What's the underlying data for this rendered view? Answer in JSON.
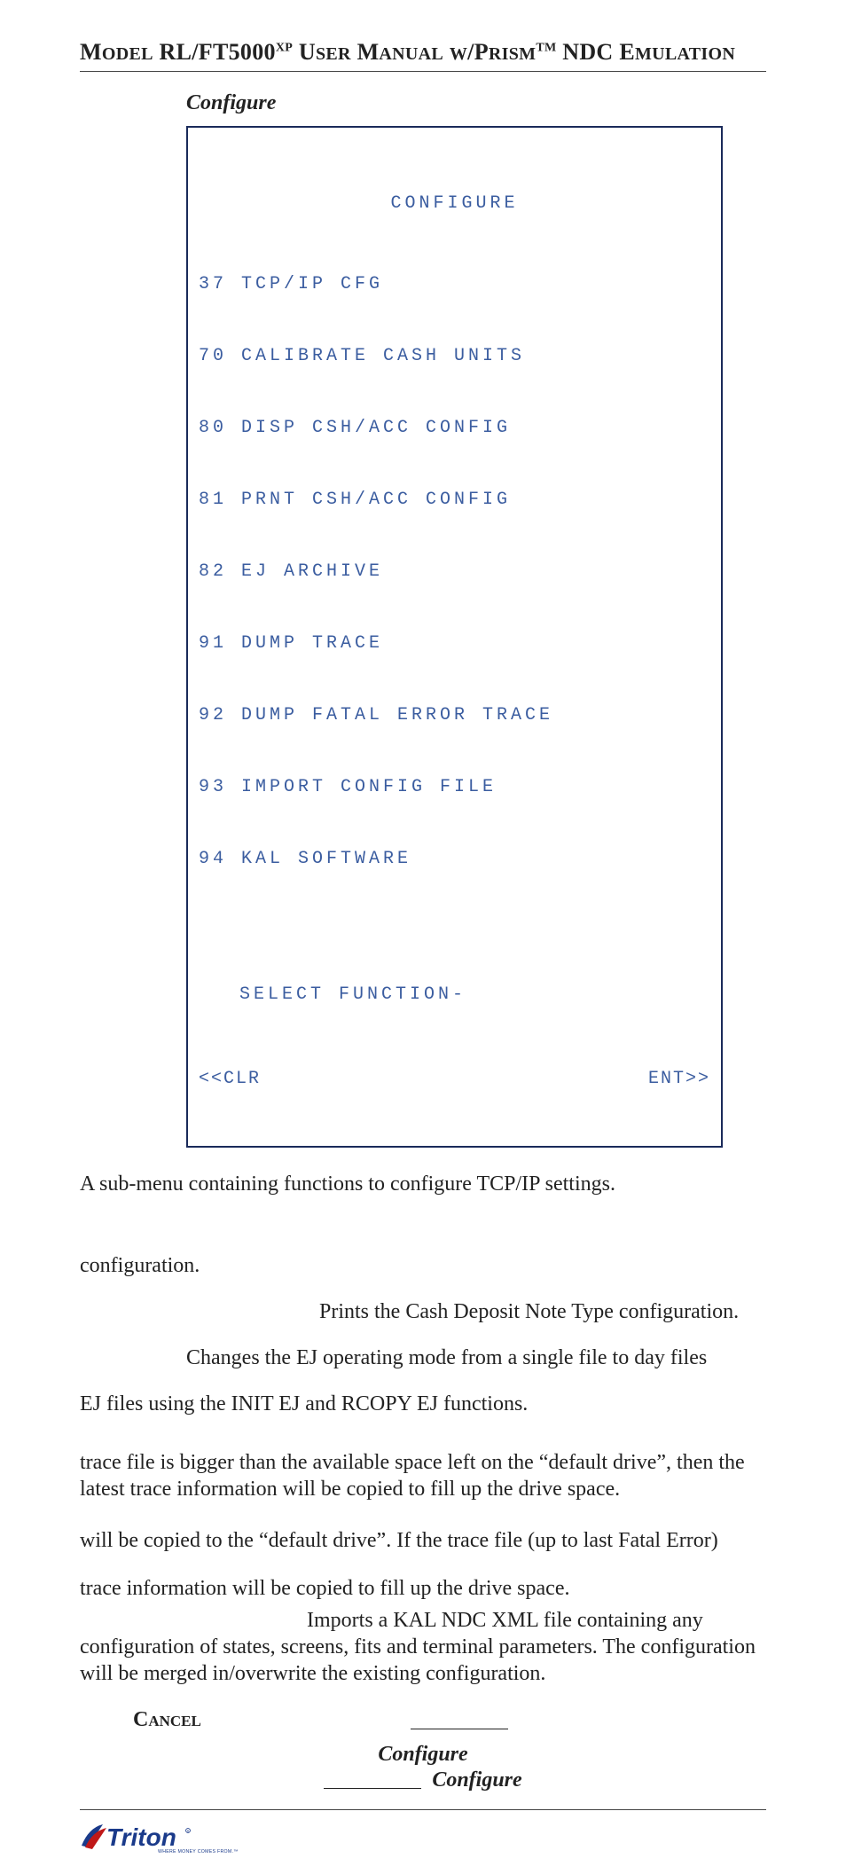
{
  "header": {
    "title_html": "M<span style='font-size:20px'>ODEL</span> RL/FT5000<sup style='font-size:14px'>XP</sup> U<span style='font-size:20px'>SER</span> M<span style='font-size:20px'>ANUAL</span> <span style='font-size:20px'>W</span>/P<span style='font-size:20px'>RISM</span><sup style='font-size:14px'>TM</sup> NDC E<span style='font-size:20px'>MULATION</span>"
  },
  "section_label": "Configure",
  "terminal": {
    "title": "CONFIGURE",
    "lines": [
      "37 TCP/IP CFG",
      "70 CALIBRATE CASH UNITS",
      "80 DISP CSH/ACC CONFIG",
      "81 PRNT CSH/ACC CONFIG",
      "82 EJ ARCHIVE",
      "91 DUMP TRACE",
      "92 DUMP FATAL ERROR TRACE",
      "93 IMPORT CONFIG FILE",
      "94 KAL SOFTWARE"
    ],
    "prompt": "SELECT FUNCTION-",
    "left": "<<CLR",
    "right": "ENT>>"
  },
  "para": {
    "p1": "A sub-menu containing functions to configure TCP/IP settings.",
    "p2": "configuration.",
    "p3": "Prints the Cash Deposit Note Type configuration.",
    "p4": "Changes the EJ operating mode from a single file to day files",
    "p5": "EJ files using the INIT EJ and RCOPY EJ functions.",
    "p6": "trace file is bigger than the available space left on the “default drive”, then the latest trace information will be copied to fill up the drive space.",
    "p7": "will be copied to the “default drive”.  If the trace file (up to last Fatal Error)",
    "p8": "trace information will be copied to fill up the drive space.",
    "p9a": "Imports a KAL NDC XML file containing any",
    "p9b": "configuration of states, screens, fits and terminal parameters.  The configuration will be merged in/overwrite the existing configuration."
  },
  "cancel_label": "Cancel",
  "bottom_config": {
    "line1": "Configure",
    "line2": "Configure"
  },
  "logo": {
    "brand": "Triton",
    "tagline": "WHERE MONEY COMES FROM.™"
  }
}
